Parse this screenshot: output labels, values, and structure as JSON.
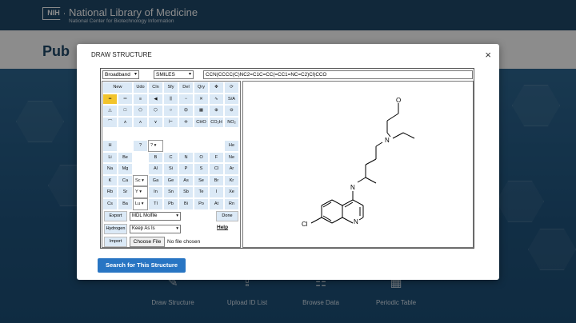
{
  "header": {
    "nih_badge": "NIH",
    "org_title": "National Library of Medicine",
    "org_subtitle": "National Center for Biotechnology Information",
    "brand_partial": "Pub"
  },
  "bottom_tools": [
    {
      "label": "Draw Structure",
      "icon": "pencil-molecule-icon"
    },
    {
      "label": "Upload ID List",
      "icon": "upload-icon"
    },
    {
      "label": "Browse Data",
      "icon": "tree-icon"
    },
    {
      "label": "Periodic Table",
      "icon": "grid-table-icon"
    }
  ],
  "modal": {
    "title": "DRAW STRUCTURE",
    "close_symbol": "×",
    "mode_select": "Broadband",
    "format_select": "SMILES",
    "smiles_value": "CCN(CCCC(C)NC2=C1C=CC(=CC1=NC=C2)Cl)CCO",
    "toolbar": [
      [
        "New",
        "Udo",
        "Cln",
        "Sfy",
        "Del",
        "Qry",
        "move",
        "rotate",
        "flip-h",
        "flip-v"
      ],
      [
        "single",
        "double",
        "triple",
        "wedge",
        "hash",
        "dash",
        "cross",
        "wavy",
        "S/A",
        "D/A",
        "S/D"
      ],
      [
        "triangle",
        "square",
        "pentagon",
        "hexagon",
        "heptagon",
        "benzene",
        "grid",
        "plus-circle",
        "minus-circle"
      ],
      [
        "chain1",
        "chain2",
        "chain3",
        "chain4",
        "chain5",
        "chain6",
        "cross-plus",
        "CHO",
        "CO2H",
        "NO2",
        "SO3H"
      ]
    ],
    "row1_labels": [
      "New",
      "Udo",
      "Cln",
      "Sfy",
      "Del",
      "Qry"
    ],
    "row2_labels": [
      "S/A",
      "D/A",
      "S/D"
    ],
    "row4_labels": [
      "CHO",
      "CO₂H",
      "NO₂",
      "SO₃H"
    ],
    "elements": [
      [
        "H",
        "",
        "?",
        "?",
        "",
        "",
        "",
        "",
        "He"
      ],
      [
        "Li",
        "Be",
        "",
        "",
        "B",
        "C",
        "N",
        "O",
        "F",
        "Ne"
      ],
      [
        "Na",
        "Mg",
        "",
        "",
        "Al",
        "Si",
        "P",
        "S",
        "Cl",
        "Ar"
      ],
      [
        "K",
        "Ca",
        "Sc",
        "Sc",
        "Ga",
        "Ge",
        "As",
        "Se",
        "Br",
        "Kr"
      ],
      [
        "Rb",
        "Sr",
        "Y",
        "Y",
        "In",
        "Sn",
        "Sb",
        "Te",
        "I",
        "Xe"
      ],
      [
        "Cs",
        "Ba",
        "Lu",
        "Lu",
        "Tl",
        "Pb",
        "Bi",
        "Po",
        "At",
        "Rn"
      ]
    ],
    "export": {
      "button": "Export",
      "select": "MDL Molfile",
      "done": "Done"
    },
    "hydrogen": {
      "button": "Hydrogen",
      "select": "Keep As Is",
      "help": "Help"
    },
    "import": {
      "button": "Import",
      "choose": "Choose File",
      "filename": "No file chosen"
    },
    "molecule_atoms": {
      "O": "O",
      "N1": "N",
      "N2": "N",
      "N3": "N",
      "Cl": "Cl"
    },
    "search_button": "Search for This Structure"
  }
}
